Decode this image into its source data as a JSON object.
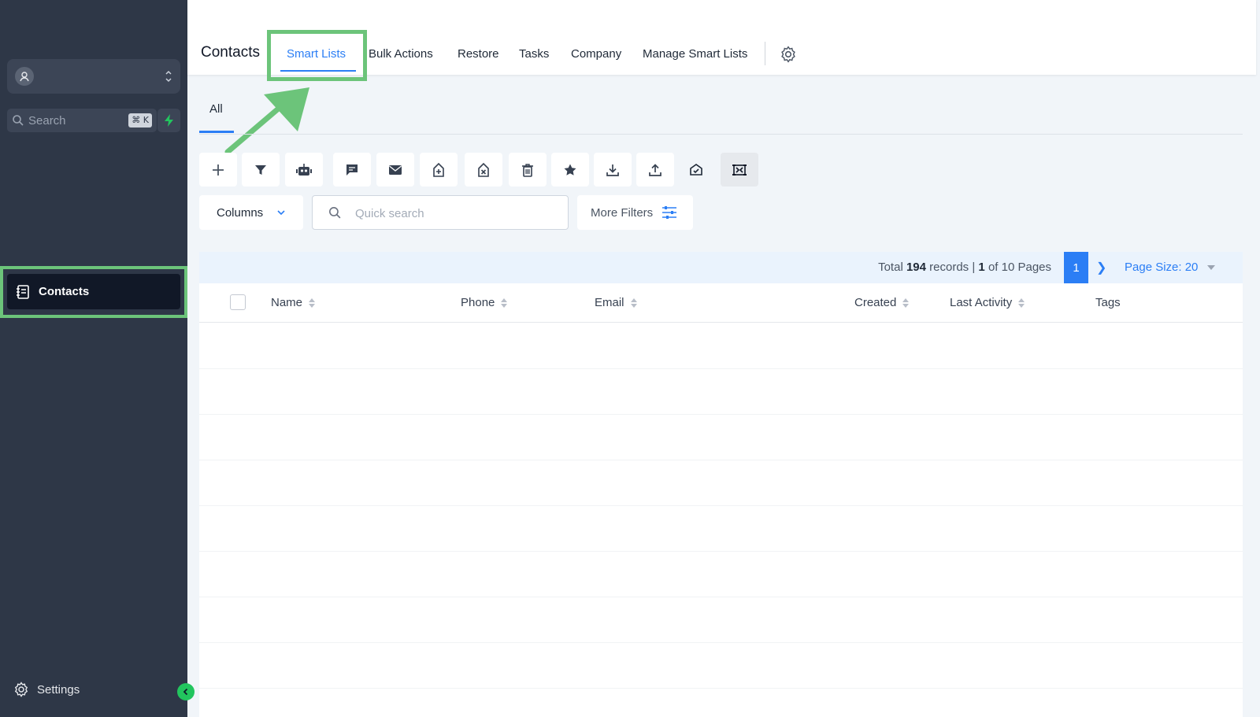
{
  "sidebar": {
    "search_label": "Search",
    "search_shortcut": "⌘ K",
    "nav_contacts": "Contacts",
    "nav_settings": "Settings"
  },
  "header": {
    "title": "Contacts",
    "tabs": [
      {
        "label": "Smart Lists",
        "active": true
      },
      {
        "label": "Bulk Actions"
      },
      {
        "label": "Restore"
      },
      {
        "label": "Tasks"
      },
      {
        "label": "Company"
      },
      {
        "label": "Manage Smart Lists"
      }
    ]
  },
  "subtabs": {
    "all": "All"
  },
  "toolbar": {
    "icons": [
      "plus-icon",
      "filter-icon",
      "robot-icon",
      "message-icon",
      "mail-icon",
      "tag-add-icon",
      "tag-remove-icon",
      "trash-icon",
      "star-icon",
      "download-icon",
      "upload-icon",
      "mail-check-icon",
      "merge-icon"
    ]
  },
  "filters": {
    "columns_label": "Columns",
    "quick_search_placeholder": "Quick search",
    "more_filters_label": "More Filters"
  },
  "table": {
    "total_prefix": "Total",
    "total_records": "194",
    "records_word": "records |",
    "current_page": "1",
    "of_pages_text": "of 10 Pages",
    "page_size": "Page Size: 20",
    "columns": [
      "Name",
      "Phone",
      "Email",
      "Created",
      "Last Activity",
      "Tags"
    ]
  },
  "colors": {
    "sidebar_bg": "#2e3747",
    "accent_blue": "#2b7ef5",
    "highlight_green": "#6cc47a",
    "bolt_green": "#22c55e"
  }
}
